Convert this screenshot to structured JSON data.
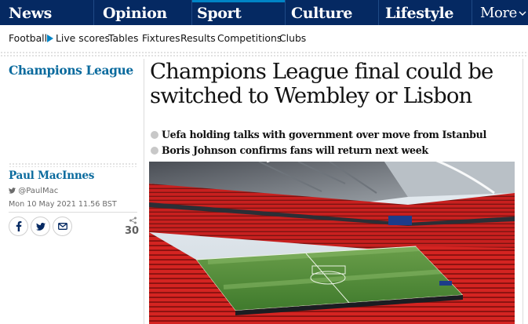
{
  "nav": {
    "items": [
      "News",
      "Opinion",
      "Sport",
      "Culture",
      "Lifestyle"
    ],
    "more": "More",
    "active": "Sport"
  },
  "subnav": {
    "items": [
      "Football",
      "Live scores",
      "Tables",
      "Fixtures",
      "Results",
      "Competitions",
      "Clubs"
    ]
  },
  "section": "Champions League",
  "byline": {
    "author": "Paul MacInnes",
    "twitter": "@PaulMac",
    "date": "Mon 10 May 2021 11.56 BST"
  },
  "share": {
    "icons": [
      "facebook-icon",
      "twitter-icon",
      "email-icon"
    ],
    "comment_count": "30"
  },
  "article": {
    "headline": "Champions League final could be switched to Wembley or Lisbon",
    "bullets": [
      "Uefa holding talks with government over move from Istanbul",
      "Boris Johnson confirms fans will return next week"
    ],
    "image": "stadium-photo"
  },
  "colors": {
    "nav_bg": "#052962",
    "accent": "#0084c6",
    "section": "#0b6b9e"
  }
}
